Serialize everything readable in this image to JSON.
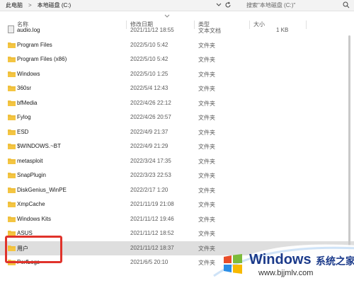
{
  "address_bar": {
    "breadcrumbs": [
      "此电脑",
      "本地磁盘 (C:)"
    ],
    "separator": ">",
    "search_placeholder": "搜索\"本地磁盘 (C:)\""
  },
  "columns": {
    "name": "名称",
    "modified": "修改日期",
    "type": "类型",
    "size": "大小"
  },
  "rows": [
    {
      "name": "audio.log",
      "date": "2021/11/12 18:55",
      "type": "文本文档",
      "size": "1 KB",
      "icon": "text-file-icon"
    },
    {
      "name": "Program Files",
      "date": "2022/5/10 5:42",
      "type": "文件夹",
      "size": "",
      "icon": "folder-icon"
    },
    {
      "name": "Program Files (x86)",
      "date": "2022/5/10 5:42",
      "type": "文件夹",
      "size": "",
      "icon": "folder-icon"
    },
    {
      "name": "Windows",
      "date": "2022/5/10 1:25",
      "type": "文件夹",
      "size": "",
      "icon": "folder-icon"
    },
    {
      "name": "360sr",
      "date": "2022/5/4 12:43",
      "type": "文件夹",
      "size": "",
      "icon": "folder-icon"
    },
    {
      "name": "bfMedia",
      "date": "2022/4/26 22:12",
      "type": "文件夹",
      "size": "",
      "icon": "folder-icon"
    },
    {
      "name": "Fylog",
      "date": "2022/4/26 20:57",
      "type": "文件夹",
      "size": "",
      "icon": "folder-icon"
    },
    {
      "name": "ESD",
      "date": "2022/4/9 21:37",
      "type": "文件夹",
      "size": "",
      "icon": "folder-icon"
    },
    {
      "name": "$WINDOWS.~BT",
      "date": "2022/4/9 21:29",
      "type": "文件夹",
      "size": "",
      "icon": "folder-icon"
    },
    {
      "name": "metasploit",
      "date": "2022/3/24 17:35",
      "type": "文件夹",
      "size": "",
      "icon": "folder-icon"
    },
    {
      "name": "SnapPlugin",
      "date": "2022/3/23 22:53",
      "type": "文件夹",
      "size": "",
      "icon": "folder-icon"
    },
    {
      "name": "DiskGenius_WinPE",
      "date": "2022/2/17 1:20",
      "type": "文件夹",
      "size": "",
      "icon": "folder-icon"
    },
    {
      "name": "XmpCache",
      "date": "2021/11/19 21:08",
      "type": "文件夹",
      "size": "",
      "icon": "folder-icon"
    },
    {
      "name": "Windows Kits",
      "date": "2021/11/12 19:46",
      "type": "文件夹",
      "size": "",
      "icon": "folder-icon"
    },
    {
      "name": "ASUS",
      "date": "2021/11/12 18:52",
      "type": "文件夹",
      "size": "",
      "icon": "folder-icon"
    },
    {
      "name": "用户",
      "date": "2021/11/12 18:37",
      "type": "文件夹",
      "size": "",
      "icon": "folder-icon",
      "selected": true
    },
    {
      "name": "PerfLogs",
      "date": "2021/6/5 20:10",
      "type": "文件夹",
      "size": "",
      "icon": "folder-icon"
    }
  ],
  "watermark": {
    "brand": "Windows",
    "brand_cn": "系统之家",
    "url": "www.bjjmlv.com"
  },
  "colors": {
    "folder": "#f4c542",
    "selection": "#dedede",
    "highlight_box": "#e0332b",
    "watermark_text": "#1b3a8a"
  }
}
